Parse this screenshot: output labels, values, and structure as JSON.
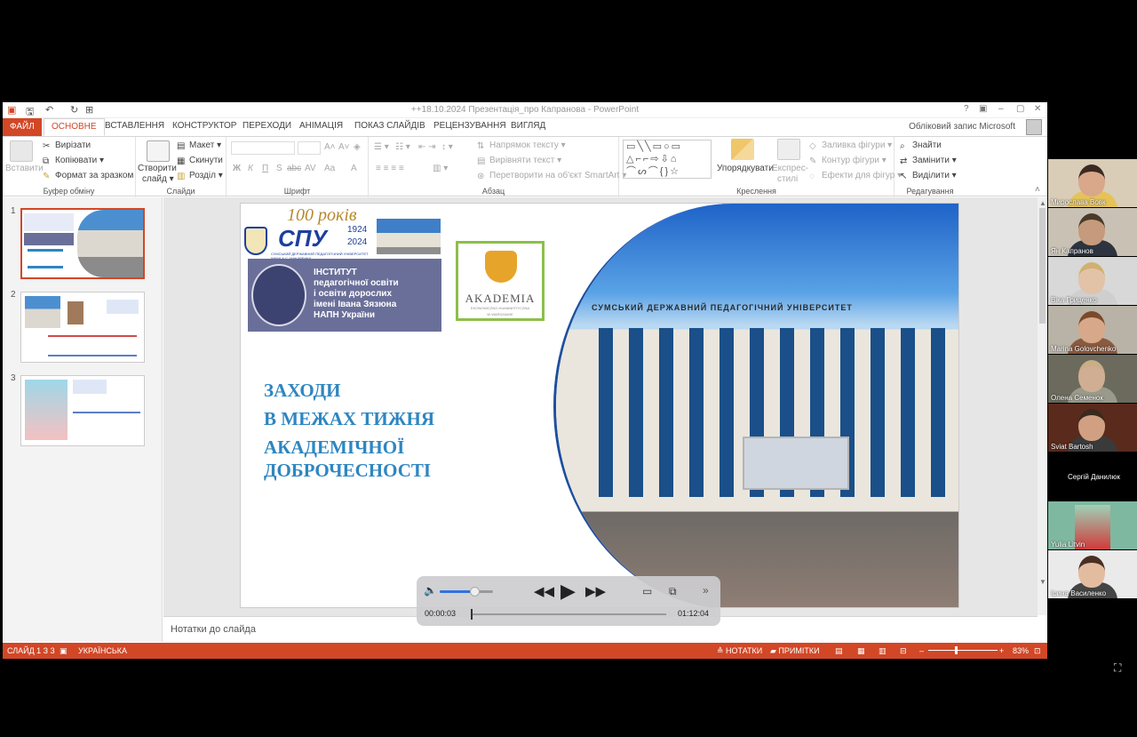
{
  "window": {
    "title": "++18.10.2024 Презентація_про Капранова - PowerPoint",
    "help": "?",
    "controls": [
      "▣",
      "–",
      "▢",
      "✕"
    ]
  },
  "ribbon_tabs": [
    "ФАЙЛ",
    "ОСНОВНЕ",
    "ВСТАВЛЕННЯ",
    "КОНСТРУКТОР",
    "ПЕРЕХОДИ",
    "АНІМАЦІЯ",
    "ПОКАЗ СЛАЙДІВ",
    "РЕЦЕНЗУВАННЯ",
    "ВИГЛЯД"
  ],
  "account": "Обліковий запис Microsoft",
  "ribbon": {
    "clipboard": {
      "paste": "Вставити",
      "cut": "Вирізати",
      "copy": "Копіювати",
      "format": "Формат за зразком",
      "label": "Буфер обміну"
    },
    "slides": {
      "new_slide_1": "Створити",
      "new_slide_2": "слайд",
      "layout": "Макет",
      "reset": "Скинути",
      "section": "Розділ",
      "label": "Слайди"
    },
    "font": {
      "bold": "Ж",
      "italic": "К",
      "underline": "П",
      "shadow": "S",
      "strike": "abc",
      "spacing": "AV",
      "case": "Aa",
      "color": "A",
      "label": "Шрифт"
    },
    "paragraph": {
      "text_direction": "Напрямок тексту",
      "align_text": "Вирівняти текст",
      "smartart": "Перетворити на об'єкт SmartArt",
      "label": "Абзац"
    },
    "drawing": {
      "arrange": "Упорядкувати",
      "quick_styles_1": "Експрес-",
      "quick_styles_2": "стилі",
      "fill": "Заливка фігури",
      "outline": "Контур фігури",
      "effects": "Ефекти для фігур",
      "label": "Креслення"
    },
    "editing": {
      "find": "Знайти",
      "replace": "Замінити",
      "select": "Виділити",
      "label": "Редагування"
    }
  },
  "slides": [
    {
      "number": "1"
    },
    {
      "number": "2"
    },
    {
      "number": "3"
    }
  ],
  "slide": {
    "anniversary": "100 років",
    "university_abbr": "СПУ",
    "years_start": "1924",
    "years_end": "2024",
    "university_full": "СУМСЬКИЙ ДЕРЖАВНИЙ ПЕДАГОГІЧНИЙ УНІВЕРСИТЕТ ІМЕНІ А.С. МАКАРЕНКА",
    "institute_lines": [
      "ІНСТИТУТ",
      "педагогічної освіти",
      "і освіти дорослих",
      "імені Івана Зязюна",
      "НАПН України"
    ],
    "akademia": "AKADEMIA",
    "akademia_sub": "EKONOMICZNO-HUMANISTYCZNA",
    "akademia_city": "W WARSZAWIE",
    "heading_lines": [
      "ЗАХОДИ",
      "В МЕЖАХ ТИЖНЯ",
      "АКАДЕМІЧНОЇ",
      "ДОБРОЧЕСНОСТІ"
    ],
    "building_sign": "СУМСЬКИЙ ДЕРЖАВНИЙ ПЕДАГОГІЧНИЙ УНІВЕРСИТЕТ"
  },
  "notes_placeholder": "Нотатки до слайда",
  "status": {
    "slide": "СЛАЙД 1 З 3",
    "language": "УКРАЇНСЬКА",
    "notes": "НОТАТКИ",
    "comments": "ПРИМІТКИ",
    "zoom": "83%"
  },
  "player": {
    "elapsed": "00:00:03",
    "total": "01:12:04",
    "volume_fraction": 0.65,
    "progress_fraction": 0.0007
  },
  "participants": [
    {
      "name": "Мирослава Вовк"
    },
    {
      "name": "Ян Капранов"
    },
    {
      "name": "Віка Гриценко"
    },
    {
      "name": "Marina Golovchenko"
    },
    {
      "name": "Олена Семенок"
    },
    {
      "name": "Sviat Bartosh"
    },
    {
      "name": "Сергій Данилюк"
    },
    {
      "name": "Yulia Litvin"
    },
    {
      "name": "Ірина Василенко"
    }
  ],
  "colors": {
    "accent": "#d24726",
    "slide_heading": "#2e86c1",
    "institute_panel": "#6a6f99",
    "spu_blue": "#1d3f9e"
  }
}
